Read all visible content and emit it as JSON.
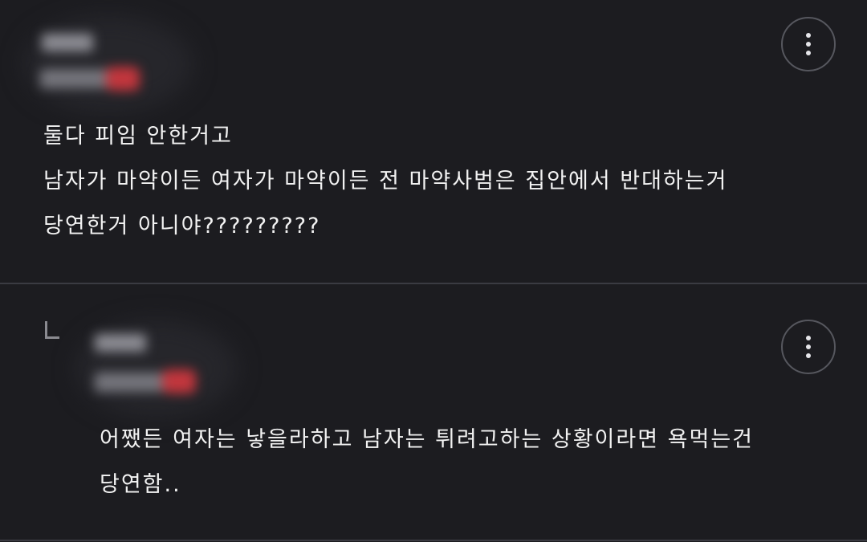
{
  "comments": [
    {
      "lines": [
        "둘다 피임 안한거고",
        "남자가 마약이든 여자가 마약이든 전 마약사범은 집안에서 반대하는거",
        "당연한거 아니야?????????"
      ]
    },
    {
      "is_reply": true,
      "reply_icon": "reply-corner-icon",
      "lines": [
        "어쨌든 여자는 낳을라하고 남자는 튀려고하는 상황이라면 욕먹는건",
        "당연함.."
      ]
    }
  ],
  "icons": {
    "more": "more-vertical-icon"
  },
  "colors": {
    "background": "#1c1c20",
    "divider": "#3a3b42",
    "text": "#f2f2f2",
    "badge": "#c2363d"
  }
}
